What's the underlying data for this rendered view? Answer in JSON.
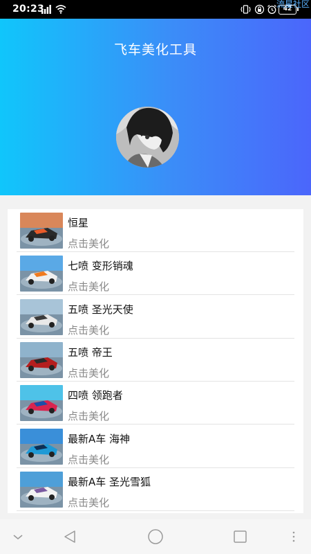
{
  "status_bar": {
    "time": "20:23",
    "battery": "42",
    "watermark": "流星社区"
  },
  "header": {
    "title": "飞车美化工具"
  },
  "list": {
    "items": [
      {
        "title": "恒星",
        "subtitle": "点击美化"
      },
      {
        "title": "七喷 变形销魂",
        "subtitle": "点击美化"
      },
      {
        "title": "五喷 圣光天使",
        "subtitle": "点击美化"
      },
      {
        "title": "五喷 帝王",
        "subtitle": "点击美化"
      },
      {
        "title": "四喷 领跑者",
        "subtitle": "点击美化"
      },
      {
        "title": "最新A车 海神",
        "subtitle": "点击美化"
      },
      {
        "title": "最新A车 圣光雪狐",
        "subtitle": "点击美化"
      }
    ]
  },
  "nav": {
    "icons": [
      "chevron-down-icon",
      "back-icon",
      "home-icon",
      "recent-apps-icon",
      "more-icon"
    ]
  },
  "colors": {
    "header_gradient_start": "#10c6fb",
    "header_gradient_end": "#4b66fb",
    "subtitle": "#8a8a8a"
  }
}
